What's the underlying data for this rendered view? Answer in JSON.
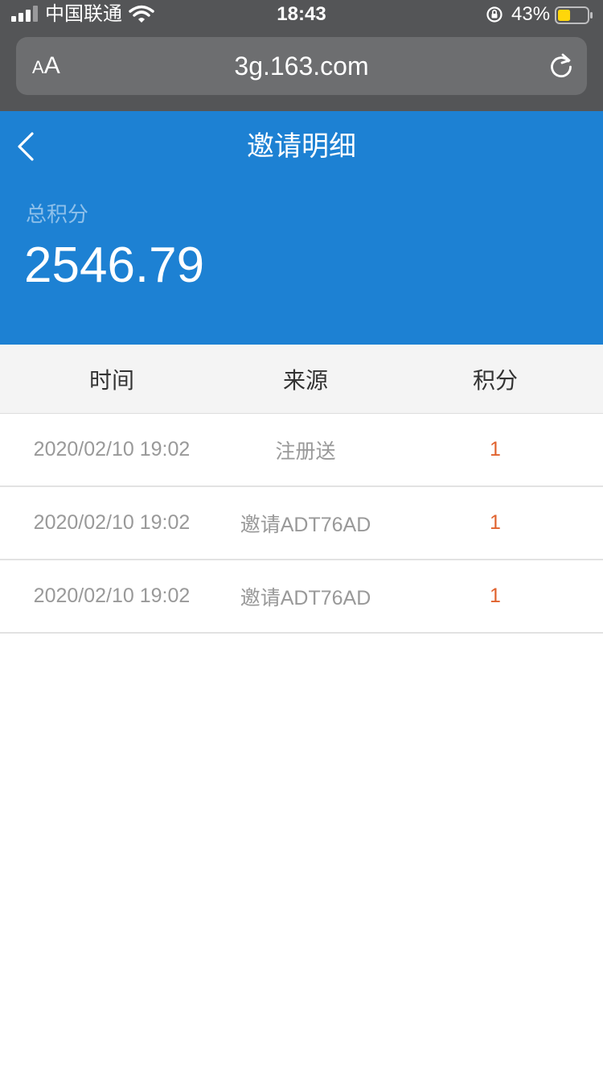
{
  "status_bar": {
    "carrier": "中国联通",
    "time": "18:43",
    "battery_percent": "43%",
    "battery_level": 0.43,
    "battery_color": "#ffd60a"
  },
  "browser": {
    "text_size_label_small": "A",
    "text_size_label_large": "A",
    "url": "3g.163.com",
    "bar_color": "#545557"
  },
  "header": {
    "title": "邀请明细",
    "points_label": "总积分",
    "points_value": "2546.79",
    "background_color": "#1d81d3",
    "back_icon": "chevron-left-icon"
  },
  "table": {
    "columns": [
      "时间",
      "来源",
      "积分"
    ],
    "rows": [
      {
        "time": "2020/02/10 19:02",
        "source": "注册送",
        "points": "1"
      },
      {
        "time": "2020/02/10 19:02",
        "source": "邀请ADT76AD",
        "points": "1"
      },
      {
        "time": "2020/02/10 19:02",
        "source": "邀请ADT76AD",
        "points": "1"
      }
    ],
    "points_color": "#e0622e"
  }
}
